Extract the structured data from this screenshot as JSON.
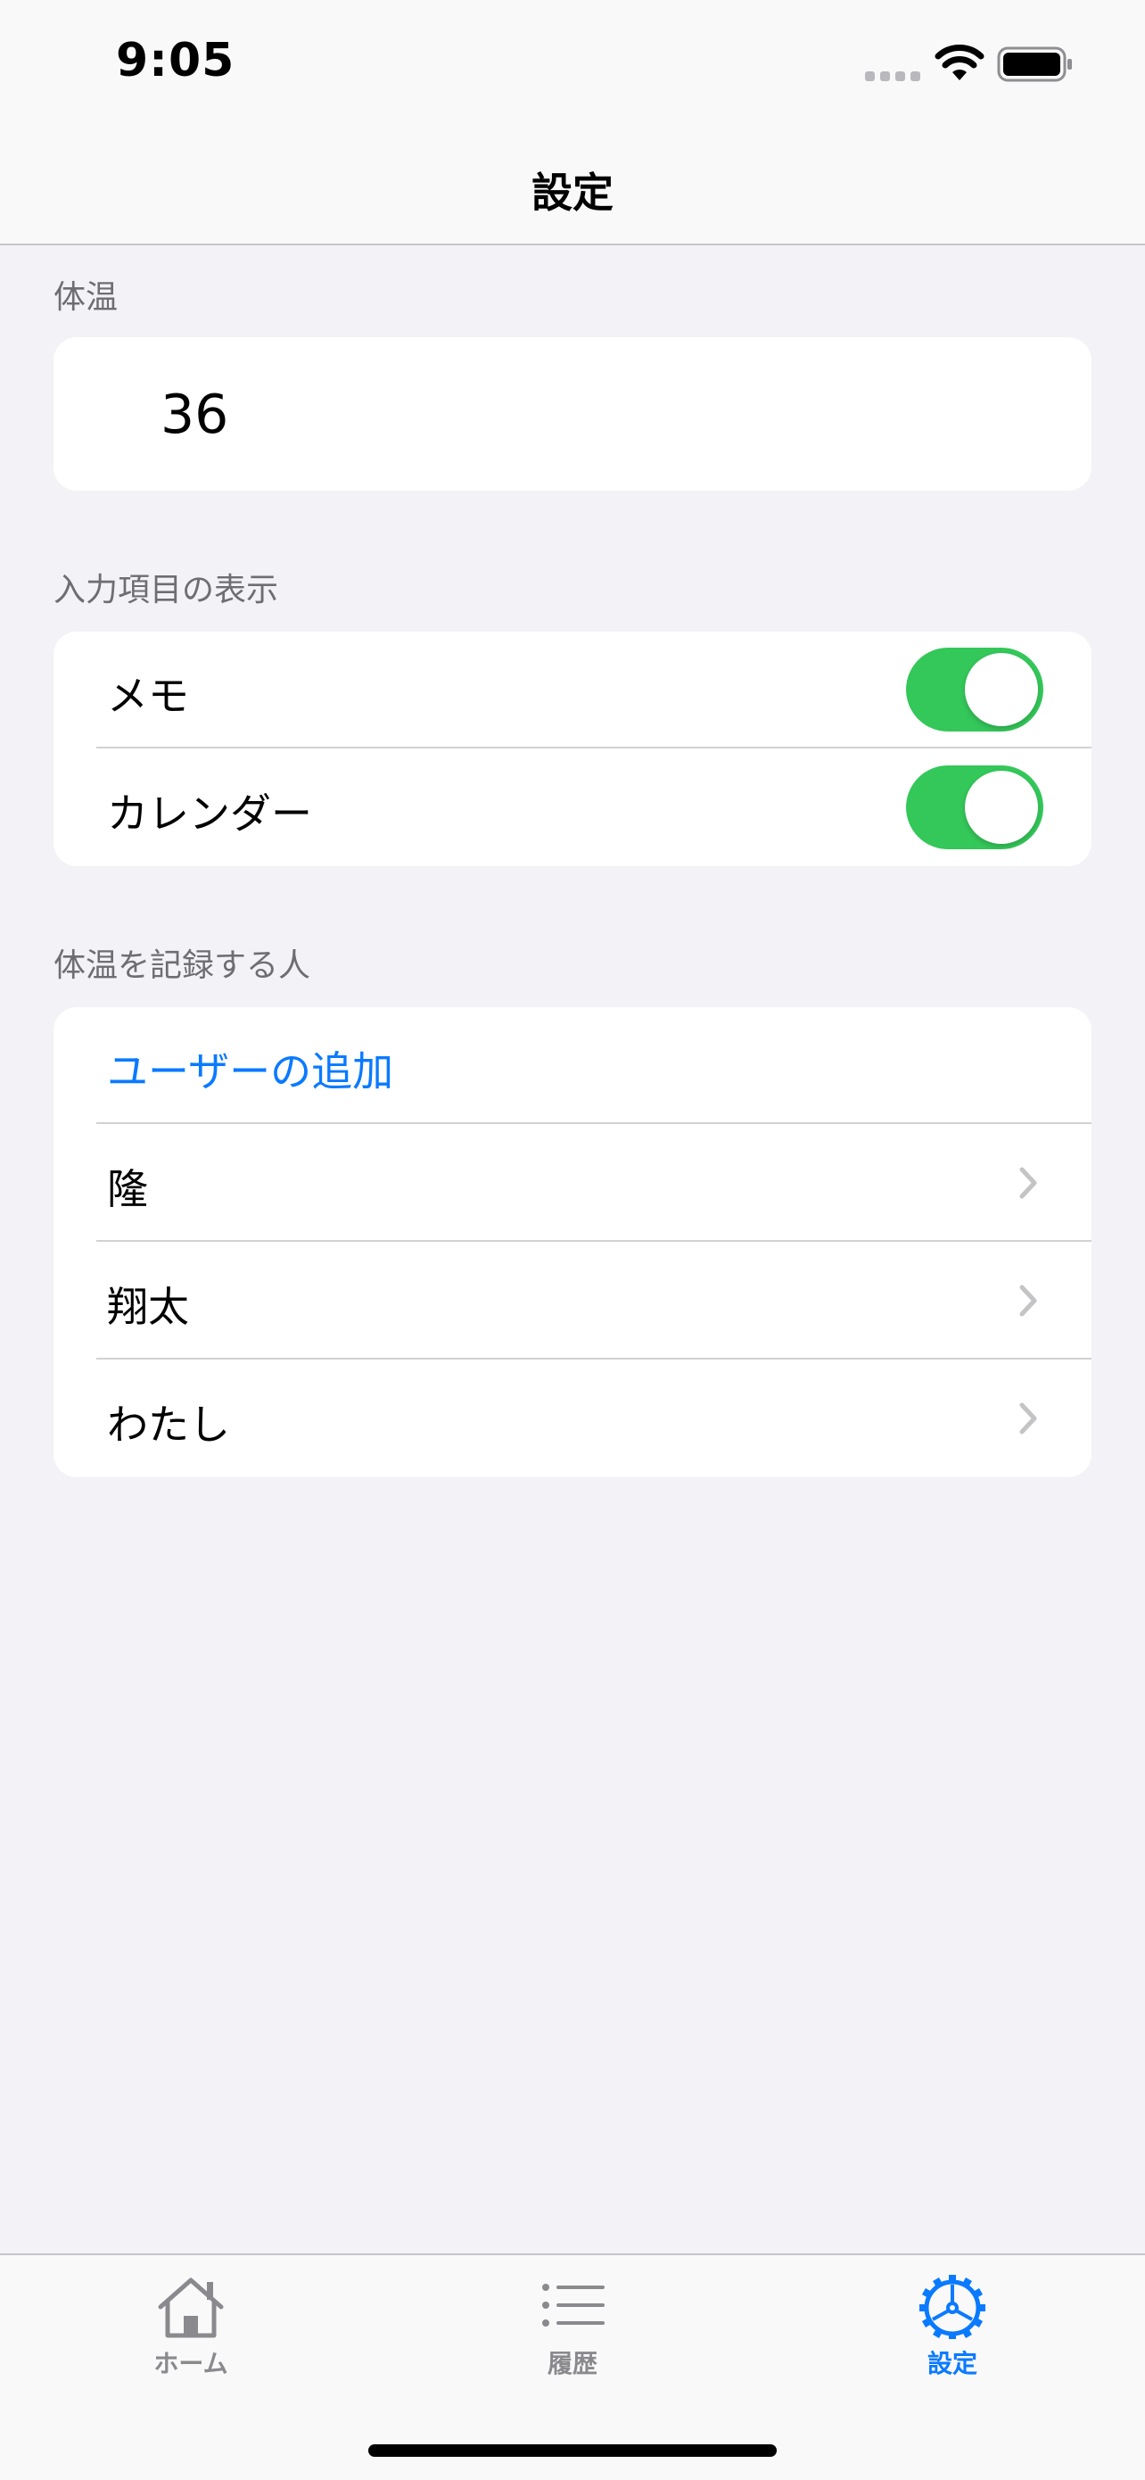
{
  "status_bar": {
    "time": "9:05"
  },
  "nav": {
    "title": "設定"
  },
  "temperature_section": {
    "header": "体温",
    "value": "36"
  },
  "display_section": {
    "header": "入力項目の表示",
    "items": [
      {
        "label": "メモ",
        "enabled": true
      },
      {
        "label": "カレンダー",
        "enabled": true
      }
    ]
  },
  "people_section": {
    "header": "体温を記録する人",
    "add_user_label": "ユーザーの追加",
    "users": [
      {
        "label": "隆"
      },
      {
        "label": "翔太"
      },
      {
        "label": "わたし"
      }
    ]
  },
  "tab_bar": {
    "tabs": [
      {
        "label": "ホーム",
        "icon": "house-icon",
        "active": false
      },
      {
        "label": "履歴",
        "icon": "list-icon",
        "active": false
      },
      {
        "label": "設定",
        "icon": "gear-icon",
        "active": true
      }
    ]
  },
  "colors": {
    "accent": "#0a7aff",
    "toggle_on": "#34c759",
    "background": "#f2f2f7"
  }
}
